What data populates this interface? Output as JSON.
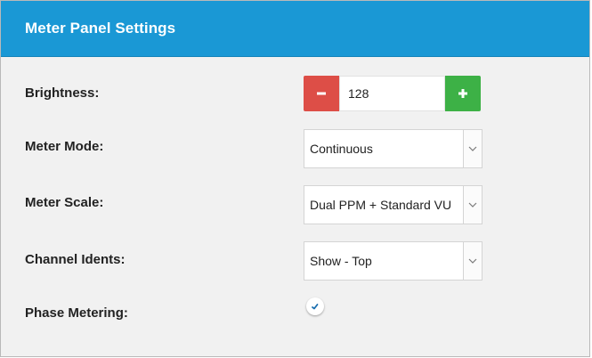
{
  "header": {
    "title": "Meter Panel Settings"
  },
  "colors": {
    "header_bg": "#1a98d5",
    "minus_button": "#dd4e47",
    "plus_button": "#3db146",
    "panel_bg": "#f1f1f1"
  },
  "settings": {
    "brightness": {
      "label": "Brightness:",
      "value": "128",
      "decrement_icon": "minus-icon",
      "increment_icon": "plus-icon"
    },
    "meter_mode": {
      "label": "Meter Mode:",
      "value": "Continuous"
    },
    "meter_scale": {
      "label": "Meter Scale:",
      "value": "Dual PPM + Standard VU"
    },
    "channel_idents": {
      "label": "Channel Idents:",
      "value": "Show - Top"
    },
    "phase_metering": {
      "label": "Phase Metering:",
      "checked": true
    }
  }
}
